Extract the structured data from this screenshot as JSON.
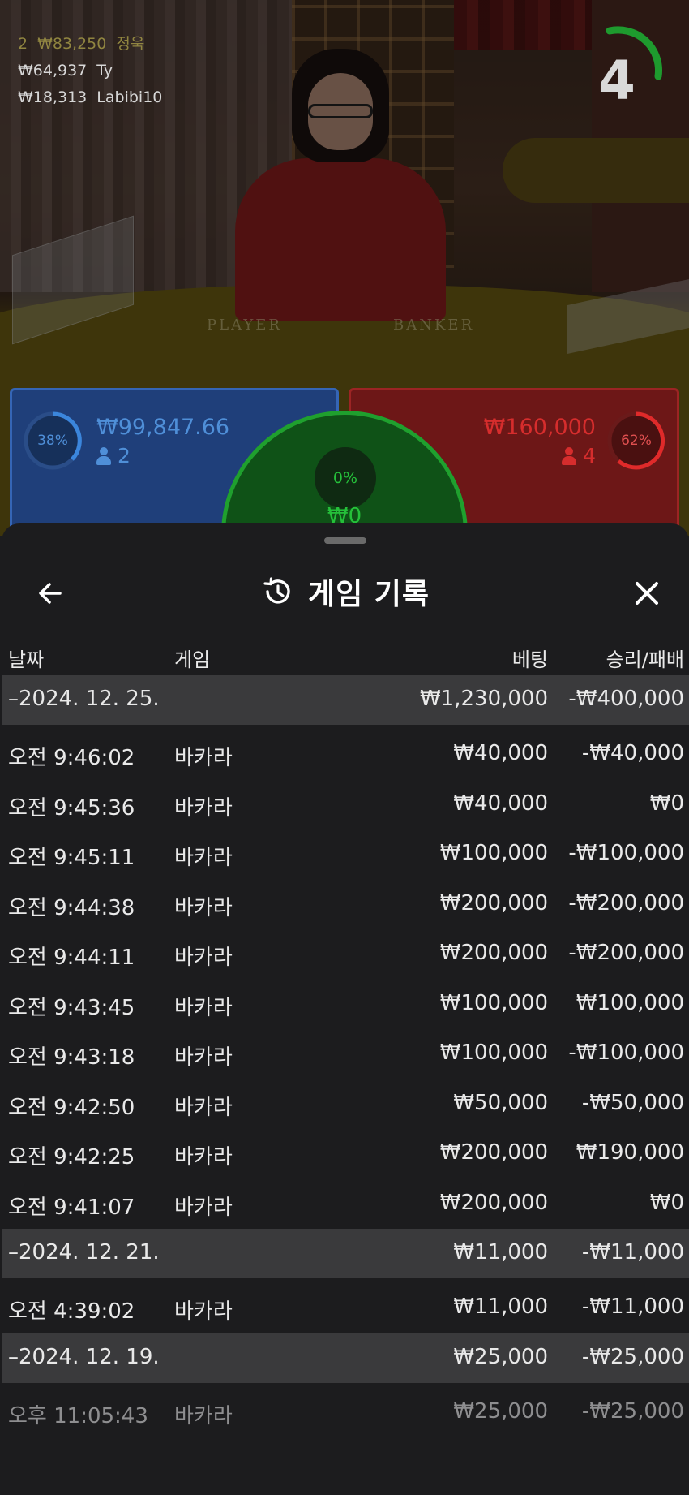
{
  "stream": {
    "players": [
      {
        "amount": "₩83,250",
        "name": "정욱"
      },
      {
        "amount": "₩64,937",
        "name": "Ty"
      },
      {
        "amount": "₩18,313",
        "name": "Labibi10"
      }
    ],
    "top_rank": "2",
    "countdown": "4",
    "table_labels": {
      "player": "PLAYER",
      "banker": "BANKER"
    }
  },
  "bets": {
    "player": {
      "percent": "38%",
      "amount": "₩99,847.66",
      "count": "2",
      "color": "#3565b5"
    },
    "tie": {
      "percent": "0%",
      "amount": "₩0",
      "color": "#1fa02e"
    },
    "banker": {
      "percent": "62%",
      "amount": "₩160,000",
      "count": "4",
      "color": "#c82424"
    }
  },
  "sheet": {
    "title": "게임 기록",
    "icons": {
      "back": "arrow-left-icon",
      "history": "history-icon",
      "close": "close-icon"
    },
    "columns": {
      "date": "날짜",
      "game": "게임",
      "bet": "베팅",
      "result": "승리/패배"
    },
    "groups": [
      {
        "date": "–2024. 12. 25.",
        "total_bet": "₩1,230,000",
        "total_result": "-₩400,000",
        "rows": [
          {
            "time": "오전 9:46:02",
            "game": "바카라",
            "bet": "₩40,000",
            "result": "-₩40,000"
          },
          {
            "time": "오전 9:45:36",
            "game": "바카라",
            "bet": "₩40,000",
            "result": "₩0"
          },
          {
            "time": "오전 9:45:11",
            "game": "바카라",
            "bet": "₩100,000",
            "result": "-₩100,000"
          },
          {
            "time": "오전 9:44:38",
            "game": "바카라",
            "bet": "₩200,000",
            "result": "-₩200,000"
          },
          {
            "time": "오전 9:44:11",
            "game": "바카라",
            "bet": "₩200,000",
            "result": "-₩200,000"
          },
          {
            "time": "오전 9:43:45",
            "game": "바카라",
            "bet": "₩100,000",
            "result": "₩100,000"
          },
          {
            "time": "오전 9:43:18",
            "game": "바카라",
            "bet": "₩100,000",
            "result": "-₩100,000"
          },
          {
            "time": "오전 9:42:50",
            "game": "바카라",
            "bet": "₩50,000",
            "result": "-₩50,000"
          },
          {
            "time": "오전 9:42:25",
            "game": "바카라",
            "bet": "₩200,000",
            "result": "₩190,000"
          },
          {
            "time": "오전 9:41:07",
            "game": "바카라",
            "bet": "₩200,000",
            "result": "₩0"
          }
        ]
      },
      {
        "date": "–2024. 12. 21.",
        "total_bet": "₩11,000",
        "total_result": "-₩11,000",
        "rows": [
          {
            "time": "오전 4:39:02",
            "game": "바카라",
            "bet": "₩11,000",
            "result": "-₩11,000"
          }
        ]
      },
      {
        "date": "–2024. 12. 19.",
        "total_bet": "₩25,000",
        "total_result": "-₩25,000",
        "rows": [
          {
            "time": "오후 11:05:43",
            "game": "바카라",
            "bet": "₩25,000",
            "result": "-₩25,000"
          }
        ]
      }
    ]
  }
}
